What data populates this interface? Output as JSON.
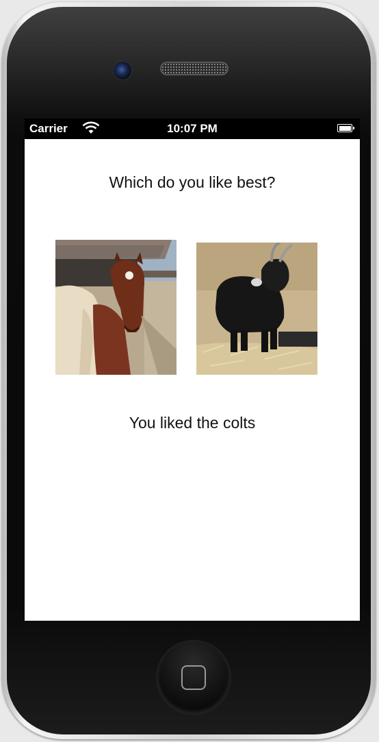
{
  "status_bar": {
    "carrier": "Carrier",
    "time": "10:07 PM",
    "wifi_icon": "wifi-icon",
    "battery_icon": "battery-icon",
    "battery_level": 1.0
  },
  "main": {
    "question": "Which do you like best?",
    "result": "You liked the colts",
    "choices": [
      {
        "name": "colts",
        "icon": "colt-photo"
      },
      {
        "name": "goat",
        "icon": "goat-photo"
      }
    ]
  },
  "device": {
    "camera_icon": "camera-icon",
    "speaker_icon": "speaker-grille",
    "home_button_icon": "home-button-icon"
  }
}
